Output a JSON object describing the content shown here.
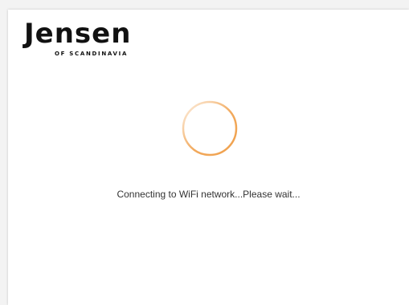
{
  "logo": {
    "brand": "Jensen",
    "tagline": "OF SCANDINAVIA"
  },
  "loader": {
    "icon": "loading-spinner-icon",
    "color": "#f0a04b"
  },
  "status": {
    "message": "Connecting to WiFi network...Please wait..."
  }
}
